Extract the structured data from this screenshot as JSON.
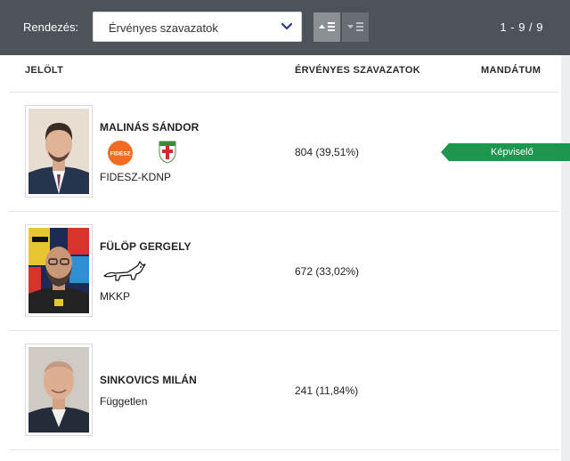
{
  "toolbar": {
    "sort_label": "Rendezés:",
    "sort_value": "Érvényes szavazatok",
    "sort_ascending_icon": "sort-ascending-icon",
    "sort_descending_icon": "sort-descending-icon",
    "pager": "1 - 9 / 9"
  },
  "table": {
    "headers": [
      "JELÖLT",
      "ÉRVÉNYES SZAVAZATOK",
      "MANDÁTUM"
    ],
    "rows": [
      {
        "name": "MALINÁS SÁNDOR",
        "party": "FIDESZ-KDNP",
        "votes": "804 (39,51%)",
        "mandate": "Képviselő",
        "party_logos": [
          "fidesz-logo",
          "kdnp-logo"
        ]
      },
      {
        "name": "FÜLÖP GERGELY",
        "party": "MKKP",
        "votes": "672 (33,02%)",
        "mandate": "",
        "party_logos": [
          "mkkp-dog-logo"
        ]
      },
      {
        "name": "SINKOVICS MILÁN",
        "party": "Független",
        "votes": "241 (11,84%)",
        "mandate": "",
        "party_logos": []
      }
    ]
  },
  "logo_text": {
    "fidesz": "FIDESZ"
  },
  "colors": {
    "toolbar_bg": "#4d5359",
    "mandate_badge": "#1e9650",
    "fidesz_orange": "#f26b21"
  }
}
